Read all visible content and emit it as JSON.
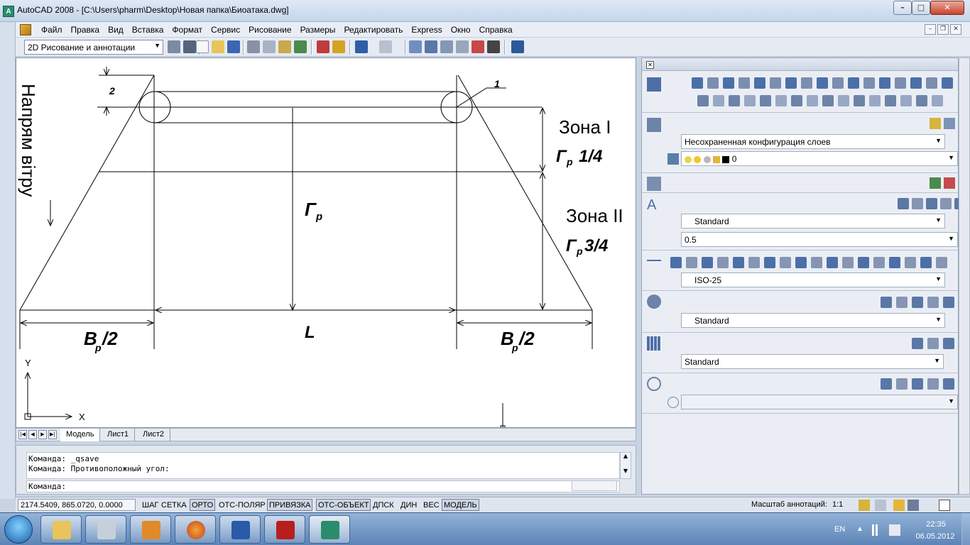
{
  "window": {
    "app_icon_letter": "A",
    "title": "AutoCAD 2008 - [C:\\Users\\pharm\\Desktop\\Новая папка\\Биоатака.dwg]",
    "min_glyph": "–",
    "max_glyph": "□",
    "close_glyph": "✕"
  },
  "menu": {
    "items": [
      "Файл",
      "Правка",
      "Вид",
      "Вставка",
      "Формат",
      "Сервис",
      "Рисование",
      "Размеры",
      "Редактировать",
      "Express",
      "Окно",
      "Справка"
    ],
    "doc_min_glyph": "–",
    "doc_restore_glyph": "❐",
    "doc_close_glyph": "✕"
  },
  "toolbar": {
    "workspace": "2D Рисование и аннотации"
  },
  "drawing": {
    "label_wind": "Напрям вітру",
    "label_zone1": "Зона I",
    "label_zone2": "Зона II",
    "label_gr": "Г",
    "label_sub": "р",
    "label_quarter": "1/4",
    "label_three_quarter": "3/4",
    "label_B": "B",
    "label_half": "/2",
    "label_L": "L",
    "label_one": "1",
    "label_two": "2",
    "ucs_x": "X",
    "ucs_y": "Y"
  },
  "tabs": {
    "nav": [
      "|◀",
      "◀",
      "▶",
      "▶|"
    ],
    "items": [
      "Модель",
      "Лист1",
      "Лист2"
    ]
  },
  "command": {
    "history": [
      "Команда:  _qsave",
      "Команда: Противоположный угол:"
    ],
    "prompt": "Команда:",
    "scroll_up": "▲",
    "scroll_down": "▼"
  },
  "status": {
    "coords": "2174.5409, 865.0720, 0.0000",
    "modes": [
      {
        "label": "ШАГ",
        "on": false
      },
      {
        "label": "СЕТКА",
        "on": false
      },
      {
        "label": "ОРТО",
        "on": true
      },
      {
        "label": "ОТС-ПОЛЯР",
        "on": false
      },
      {
        "label": "ПРИВЯЗКА",
        "on": true
      },
      {
        "label": "ОТС-ОБЪЕКТ",
        "on": true
      },
      {
        "label": "ДПСК",
        "on": false
      },
      {
        "label": "ДИН",
        "on": false
      },
      {
        "label": "ВЕС",
        "on": false
      },
      {
        "label": "МОДЕЛЬ",
        "on": true
      }
    ],
    "annotation_scale_label": "Масштаб аннотаций:",
    "annotation_scale_value": "1:1"
  },
  "palette": {
    "close_glyph": "✕",
    "layer_config": "Несохраненная конфигурация слоев",
    "layer_current": "0",
    "text_style": "Standard",
    "text_height": "0.5",
    "text_big_a": "A",
    "dim_style": "ISO-25",
    "mleader_style": "Standard",
    "table_style": "Standard",
    "dropdown_arrow": "▼"
  },
  "taskbar": {
    "lang": "EN",
    "time": "22:35",
    "date": "06.05.2012"
  },
  "colors": {
    "drawing_bg": "#ffffff",
    "line": "#000000",
    "taskbar": "#5c84b6",
    "close_red": "#c7442c"
  }
}
